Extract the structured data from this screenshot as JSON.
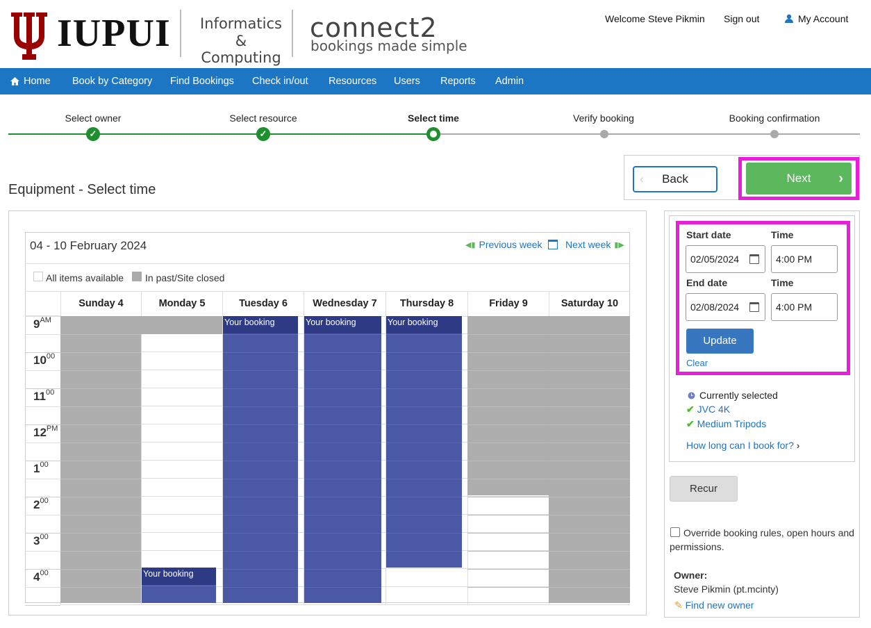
{
  "header": {
    "brand": "IUPUI",
    "school_line1": "Informatics",
    "school_line2": "& Computing",
    "app_name": "connect2",
    "app_tagline": "bookings made simple",
    "welcome": "Welcome Steve Pikmin",
    "sign_out": "Sign out",
    "my_account": "My Account"
  },
  "nav": {
    "items": [
      "Home",
      "Book by Category",
      "Find Bookings",
      "Check in/out",
      "Resources",
      "Users",
      "Reports",
      "Admin"
    ]
  },
  "stepper": {
    "steps": [
      {
        "label": "Select owner",
        "state": "done"
      },
      {
        "label": "Select resource",
        "state": "done"
      },
      {
        "label": "Select time",
        "state": "current"
      },
      {
        "label": "Verify booking",
        "state": "todo"
      },
      {
        "label": "Booking confirmation",
        "state": "todo"
      }
    ]
  },
  "actions": {
    "back": "Back",
    "next": "Next"
  },
  "page_title": "Equipment - Select time",
  "calendar": {
    "week_label": "04 - 10 February 2024",
    "prev_week": "Previous week",
    "next_week": "Next week",
    "legend_available": "All items available",
    "legend_closed": "In past/Site closed",
    "days": [
      "Sunday 4",
      "Monday 5",
      "Tuesday 6",
      "Wednesday 7",
      "Thursday 8",
      "Friday 9",
      "Saturday 10"
    ],
    "hours": [
      {
        "h": "9",
        "s": "AM"
      },
      {
        "h": "10",
        "s": "00"
      },
      {
        "h": "11",
        "s": "00"
      },
      {
        "h": "12",
        "s": "PM"
      },
      {
        "h": "1",
        "s": "00"
      },
      {
        "h": "2",
        "s": "00"
      },
      {
        "h": "3",
        "s": "00"
      },
      {
        "h": "4",
        "s": "00"
      }
    ],
    "booking_label": "Your booking"
  },
  "form": {
    "start_date_label": "Start date",
    "start_time_label": "Time",
    "start_date": "02/05/2024",
    "start_time": "4:00 PM",
    "end_date_label": "End date",
    "end_time_label": "Time",
    "end_date": "02/08/2024",
    "end_time": "4:00 PM",
    "update": "Update",
    "clear": "Clear"
  },
  "selection": {
    "currently_selected": "Currently selected",
    "items": [
      "JVC 4K",
      "Medium Tripods"
    ],
    "how_long": "How long can I book for?"
  },
  "recur": "Recur",
  "override": "Override booking rules, open hours and permissions.",
  "owner": {
    "label": "Owner:",
    "name": "Steve Pikmin (pt.mcinty)",
    "find_new": "Find new owner"
  },
  "colors": {
    "nav": "#1d76c3",
    "step_done": "#1e8f2e",
    "next_button": "#5cb85c",
    "highlight": "#e81ed8",
    "booking": "#4a58a6",
    "closed": "#aaaaaa",
    "brand_crimson": "#990000"
  }
}
